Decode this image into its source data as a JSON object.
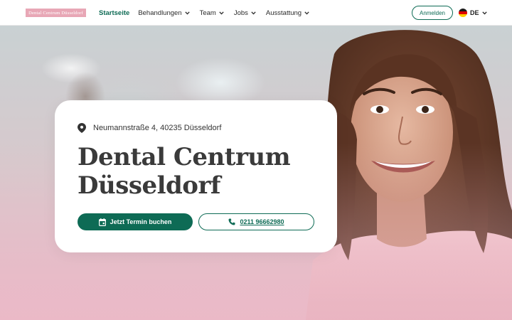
{
  "header": {
    "logo_text": "Dental Centrum Düsseldorf",
    "nav": [
      {
        "label": "Startseite",
        "active": true,
        "has_dropdown": false
      },
      {
        "label": "Behandlungen",
        "active": false,
        "has_dropdown": true
      },
      {
        "label": "Team",
        "active": false,
        "has_dropdown": true
      },
      {
        "label": "Jobs",
        "active": false,
        "has_dropdown": true
      },
      {
        "label": "Ausstattung",
        "active": false,
        "has_dropdown": true
      }
    ],
    "login_label": "Anmelden",
    "language": {
      "code": "DE",
      "flag_icon": "germany-flag-icon"
    }
  },
  "hero": {
    "address": "Neumannstraße 4, 40235 Düsseldorf",
    "title_line1": "Dental Centrum",
    "title_line2": "Düsseldorf",
    "book_label": "Jetzt Termin buchen",
    "phone_label": "0211 96662980"
  },
  "colors": {
    "accent": "#0e6b55",
    "logo_bg": "#e8a7b6",
    "text": "#3a3a3a"
  },
  "icons": {
    "address": "map-pin-icon",
    "book": "calendar-icon",
    "phone": "phone-icon",
    "dropdown": "chevron-down-icon"
  }
}
